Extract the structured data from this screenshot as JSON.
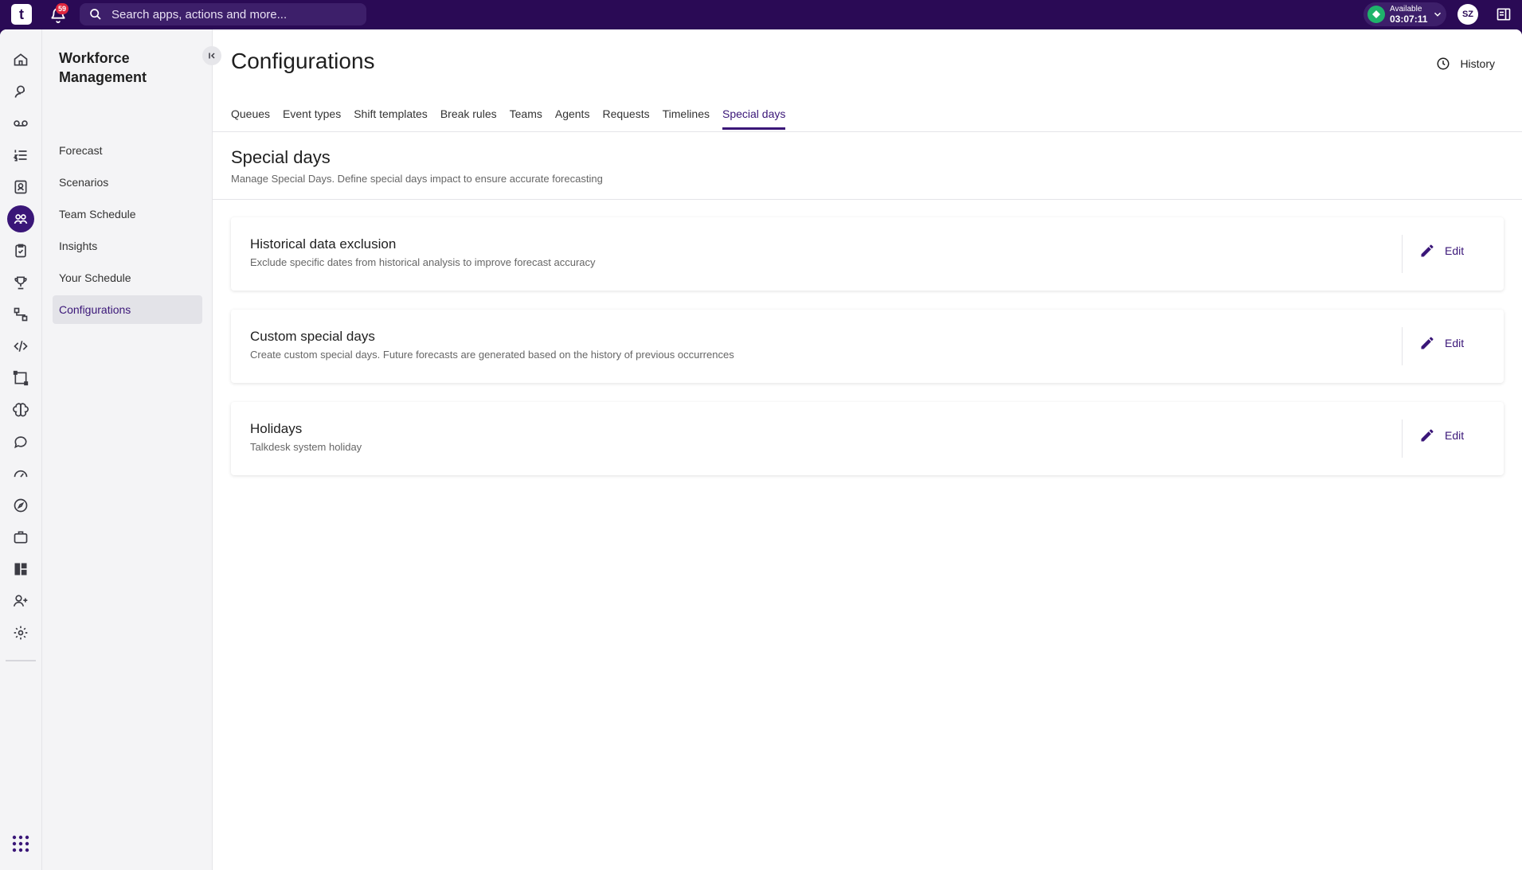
{
  "topbar": {
    "logo_glyph": "t",
    "notification_count": "59",
    "search_placeholder": "Search apps, actions and more...",
    "status_label": "Available",
    "status_timer": "03:07:11",
    "avatar_initials": "SZ",
    "colors": {
      "bar": "#2a0a55",
      "status": "#1fb36b",
      "badge": "#e0263f"
    }
  },
  "rail": {
    "items": [
      {
        "icon": "home-icon"
      },
      {
        "icon": "agent-headset-icon"
      },
      {
        "icon": "voicemail-icon"
      },
      {
        "icon": "list-numbered-icon"
      },
      {
        "icon": "contacts-icon"
      },
      {
        "icon": "workforce-people-icon",
        "active": true
      },
      {
        "icon": "clipboard-icon"
      },
      {
        "icon": "trophy-icon"
      },
      {
        "icon": "flow-icon"
      },
      {
        "icon": "code-icon"
      },
      {
        "icon": "frame-icon"
      },
      {
        "icon": "brain-icon"
      },
      {
        "icon": "chat-icon"
      },
      {
        "icon": "gauge-icon"
      },
      {
        "icon": "compass-icon"
      },
      {
        "icon": "briefcase-icon"
      },
      {
        "icon": "dashboard-icon"
      },
      {
        "icon": "user-add-icon"
      },
      {
        "icon": "gear-icon"
      }
    ]
  },
  "subnav": {
    "title": "Workforce Management",
    "items": [
      {
        "label": "Forecast"
      },
      {
        "label": "Scenarios"
      },
      {
        "label": "Team Schedule"
      },
      {
        "label": "Insights"
      },
      {
        "label": "Your Schedule"
      },
      {
        "label": "Configurations",
        "active": true
      }
    ]
  },
  "main": {
    "title": "Configurations",
    "history_label": "History",
    "tabs": [
      {
        "label": "Queues"
      },
      {
        "label": "Event types"
      },
      {
        "label": "Shift templates"
      },
      {
        "label": "Break rules"
      },
      {
        "label": "Teams"
      },
      {
        "label": "Agents"
      },
      {
        "label": "Requests"
      },
      {
        "label": "Timelines"
      },
      {
        "label": "Special days",
        "active": true
      }
    ],
    "section_title": "Special days",
    "section_subtitle": "Manage Special Days. Define special days impact to ensure accurate forecasting",
    "cards": [
      {
        "title": "Historical data exclusion",
        "description": "Exclude specific dates from historical analysis to improve forecast accuracy",
        "action": "Edit"
      },
      {
        "title": "Custom special days",
        "description": "Create custom special days. Future forecasts are generated based on the history of previous occurrences",
        "action": "Edit"
      },
      {
        "title": "Holidays",
        "description": "Talkdesk system holiday",
        "action": "Edit"
      }
    ],
    "accent_color": "#3a1678"
  }
}
